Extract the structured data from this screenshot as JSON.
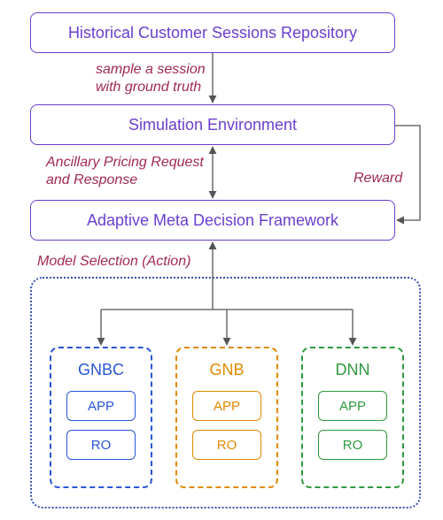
{
  "boxes": {
    "repo": "Historical Customer Sessions Repository",
    "sim": "Simulation Environment",
    "framework": "Adaptive Meta Decision Framework"
  },
  "labels": {
    "sample": "sample a session\nwith ground truth",
    "reqresp": "Ancillary Pricing Request\nand Response",
    "reward": "Reward",
    "action": "Model Selection (Action)"
  },
  "models": {
    "gnbc": {
      "title": "GNBC",
      "app": "APP",
      "ro": "RO"
    },
    "gnb": {
      "title": "GNB",
      "app": "APP",
      "ro": "RO"
    },
    "dnn": {
      "title": "DNN",
      "app": "APP",
      "ro": "RO"
    }
  }
}
